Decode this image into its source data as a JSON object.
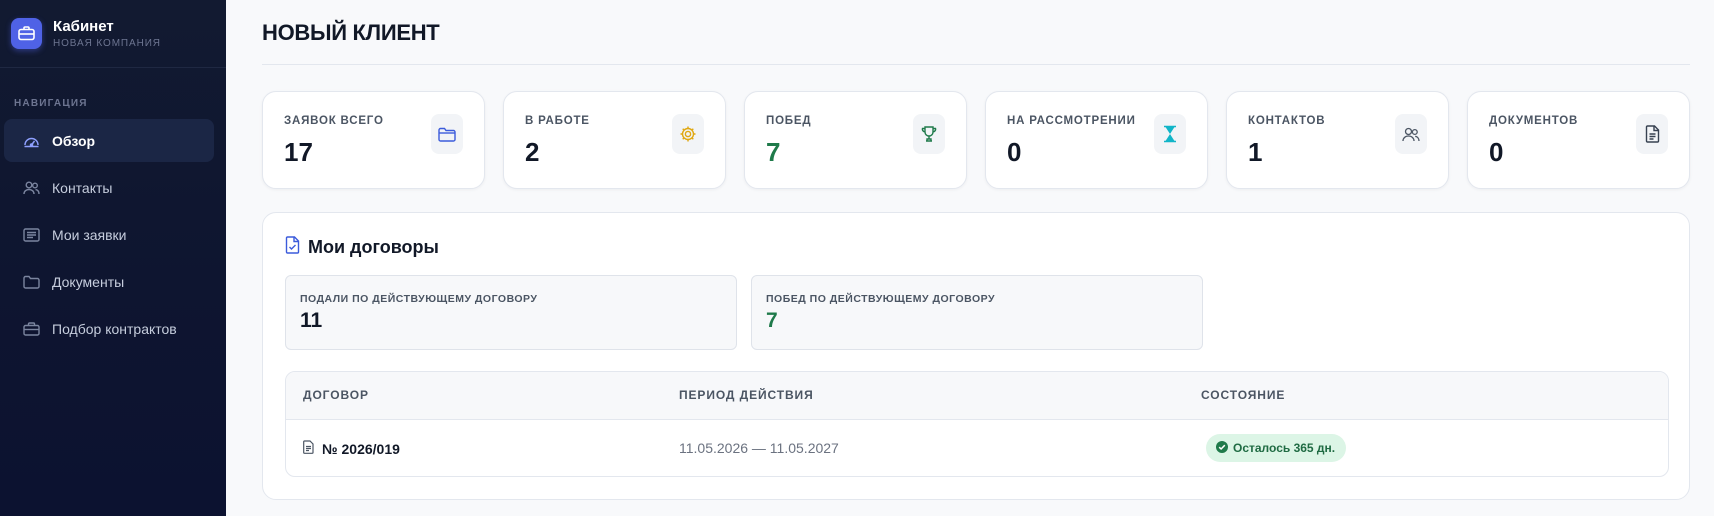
{
  "sidebar": {
    "brand_title": "Кабинет",
    "brand_subtitle": "НОВАЯ КОМПАНИЯ",
    "nav_caption": "НАВИГАЦИЯ",
    "items": [
      {
        "label": "Обзор",
        "icon": "dashboard-icon",
        "active": true
      },
      {
        "label": "Контакты",
        "icon": "users-icon",
        "active": false
      },
      {
        "label": "Мои заявки",
        "icon": "list-icon",
        "active": false
      },
      {
        "label": "Документы",
        "icon": "folder-icon",
        "active": false
      },
      {
        "label": "Подбор контрактов",
        "icon": "briefcase-icon",
        "active": false
      }
    ]
  },
  "page": {
    "title": "НОВЫЙ КЛИЕНТ"
  },
  "stats": [
    {
      "label": "ЗАЯВОК ВСЕГО",
      "value": "17",
      "icon": "folder-icon",
      "icon_color": "#3b5bdb"
    },
    {
      "label": "В РАБОТЕ",
      "value": "2",
      "icon": "gear-icon",
      "icon_color": "#e0a812"
    },
    {
      "label": "ПОБЕД",
      "value": "7",
      "icon": "trophy-icon",
      "icon_color": "#1f7a4a"
    },
    {
      "label": "НА РАССМОТРЕНИИ",
      "value": "0",
      "icon": "hourglass-icon",
      "icon_color": "#11b5c8"
    },
    {
      "label": "КОНТАКТОВ",
      "value": "1",
      "icon": "users-icon",
      "icon_color": "#4b5563"
    },
    {
      "label": "ДОКУМЕНТОВ",
      "value": "0",
      "icon": "document-icon",
      "icon_color": "#374151"
    }
  ],
  "contracts": {
    "title": "Мои договоры",
    "submitted_label": "ПОДАЛИ ПО ДЕЙСТВУЮЩЕМУ ДОГОВОРУ",
    "submitted_value": "11",
    "wins_label": "ПОБЕД ПО ДЕЙСТВУЮЩЕМУ ДОГОВОРУ",
    "wins_value": "7",
    "columns": [
      "ДОГОВОР",
      "ПЕРИОД ДЕЙСТВИЯ",
      "СОСТОЯНИЕ"
    ],
    "rows": [
      {
        "contract": "№ 2026/019",
        "period": "11.05.2026 — 11.05.2027",
        "status": "Осталось 365 дн."
      }
    ]
  },
  "colors": {
    "accent": "#4f62e6",
    "sidebar_bg": "#0e1530",
    "success_text": "#1f7a4a",
    "badge_bg": "#dcf5e6"
  }
}
